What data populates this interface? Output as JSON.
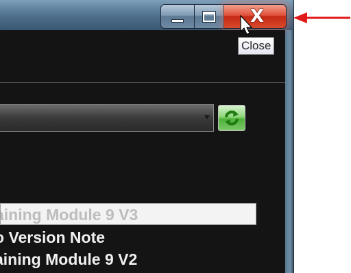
{
  "window": {
    "buttons": {
      "minimize": "minimize-icon",
      "maximize": "maximize-icon",
      "close_glyph": "X"
    },
    "tooltip": "Close"
  },
  "toolbar": {
    "refresh_icon": "refresh-icon"
  },
  "list": {
    "items": [
      {
        "label": "aining Module 9 V3",
        "selected": true
      },
      {
        "label": "o Version Note",
        "selected": false
      },
      {
        "label": "aining Module 9 V2",
        "selected": false
      }
    ]
  },
  "annotation": {
    "arrow_color": "#e01a1a"
  },
  "colors": {
    "close_button": "#d9412a",
    "client_background": "#141414",
    "selection_background": "#f3f3f3",
    "refresh_green": "#4fb23a"
  }
}
